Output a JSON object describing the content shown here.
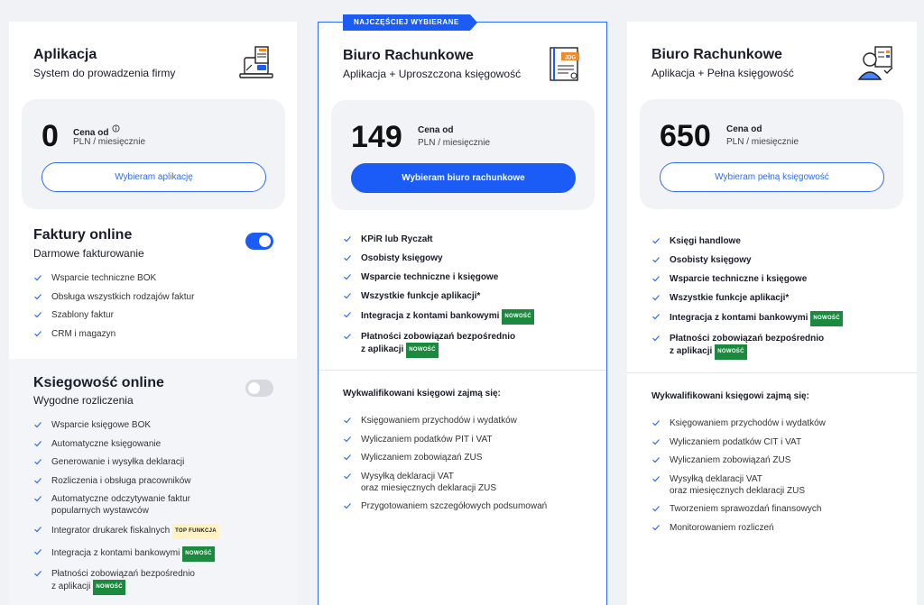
{
  "app_card": {
    "title": "Aplikacja",
    "subtitle": "System do prowadzenia firmy",
    "icon": "laptop-invoice-icon",
    "price": "0",
    "price_label": "Cena od",
    "price_unit": "PLN / miesięcznie",
    "button": "Wybieram aplikację",
    "modules": [
      {
        "title": "Faktury online",
        "subtitle": "Darmowe fakturowanie",
        "toggle": "on",
        "features": [
          "Wsparcie techniczne BOK",
          "Obsługa wszystkich rodzajów faktur",
          "Szablony faktur",
          "CRM i magazyn"
        ]
      },
      {
        "title": "Ksiegowość online",
        "subtitle": "Wygodne rozliczenia",
        "toggle": "off",
        "features": [
          {
            "text": "Wsparcie księgowe BOK"
          },
          {
            "text": "Automatyczne księgowanie"
          },
          {
            "text": "Generowanie i wysyłka deklaracji"
          },
          {
            "text": "Rozliczenia i obsługa pracowników"
          },
          {
            "text": "Automatyczne odczytywanie faktur",
            "line2": "popularnych wystawców"
          },
          {
            "text": "Integrator drukarek fiskalnych",
            "tag": "TOP FUNKCJA"
          },
          {
            "text": "Integracja z kontami bankowymi",
            "tag": "NOWOŚĆ"
          },
          {
            "text": "Płatności zobowiązań bezpośrednio",
            "line2": "z aplikacji",
            "tag2": "NOWOŚĆ"
          }
        ]
      }
    ]
  },
  "mid_card": {
    "badge": "NAJCZĘŚCIEJ WYBIERANE",
    "title": "Biuro Rachunkowe",
    "subtitle": "Aplikacja + Uproszczona księgowość",
    "icon_text": "JDG",
    "price": "149",
    "price_label": "Cena od",
    "price_unit": "PLN / miesięcznie",
    "button": "Wybieram biuro rachunkowe",
    "features": [
      {
        "text": "KPiR lub Ryczałt"
      },
      {
        "text": "Osobisty księgowy"
      },
      {
        "text": "Wsparcie techniczne i księgowe"
      },
      {
        "text": "Wszystkie funkcje aplikacji*"
      },
      {
        "text": "Integracja z kontami bankowymi",
        "tag": "NOWOŚĆ"
      },
      {
        "text": "Płatności zobowiązań bezpośrednio",
        "line2": "z aplikacji",
        "tag2": "NOWOŚĆ"
      }
    ],
    "section_title": "Wykwalifikowani księgowi zajmą się:",
    "tasks": [
      {
        "text": "Księgowaniem przychodów i wydatków"
      },
      {
        "text": "Wyliczaniem podatków PIT i VAT"
      },
      {
        "text": "Wyliczaniem zobowiązań ZUS"
      },
      {
        "text": "Wysyłką deklaracji VAT",
        "line2": "oraz miesięcznych deklaracji ZUS"
      },
      {
        "text": "Przygotowaniem szczegółowych podsumowań"
      }
    ]
  },
  "right_card": {
    "title": "Biuro Rachunkowe",
    "subtitle": "Aplikacja + Pełna księgowość",
    "icon": "accountant-person-icon",
    "price": "650",
    "price_label": "Cena od",
    "price_unit": "PLN / miesięcznie",
    "button": "Wybieram pełną księgowość",
    "features": [
      {
        "text": "Księgi handlowe"
      },
      {
        "text": "Osobisty księgowy"
      },
      {
        "text": "Wsparcie techniczne i księgowe"
      },
      {
        "text": "Wszystkie funkcje aplikacji*"
      },
      {
        "text": "Integracja z kontami bankowymi",
        "tag": "NOWOŚĆ"
      },
      {
        "text": "Płatności zobowiązań bezpośrednio",
        "line2": "z aplikacji",
        "tag2": "NOWOŚĆ"
      }
    ],
    "section_title": "Wykwalifikowani księgowi zajmą się:",
    "tasks": [
      {
        "text": "Księgowaniem przychodów i wydatków"
      },
      {
        "text": "Wyliczaniem podatków CIT i VAT"
      },
      {
        "text": "Wyliczaniem zobowiązań ZUS"
      },
      {
        "text": "Wysyłką deklaracji VAT",
        "line2": "oraz miesięcznych deklaracji ZUS"
      },
      {
        "text": "Tworzeniem sprawozdań finansowych"
      },
      {
        "text": "Monitorowaniem rozliczeń"
      }
    ]
  },
  "colors": {
    "accent": "#1a5cf5",
    "tag_new": "#1b8a3e",
    "tag_top": "#fff3c4",
    "check": "#2f6cf5"
  }
}
